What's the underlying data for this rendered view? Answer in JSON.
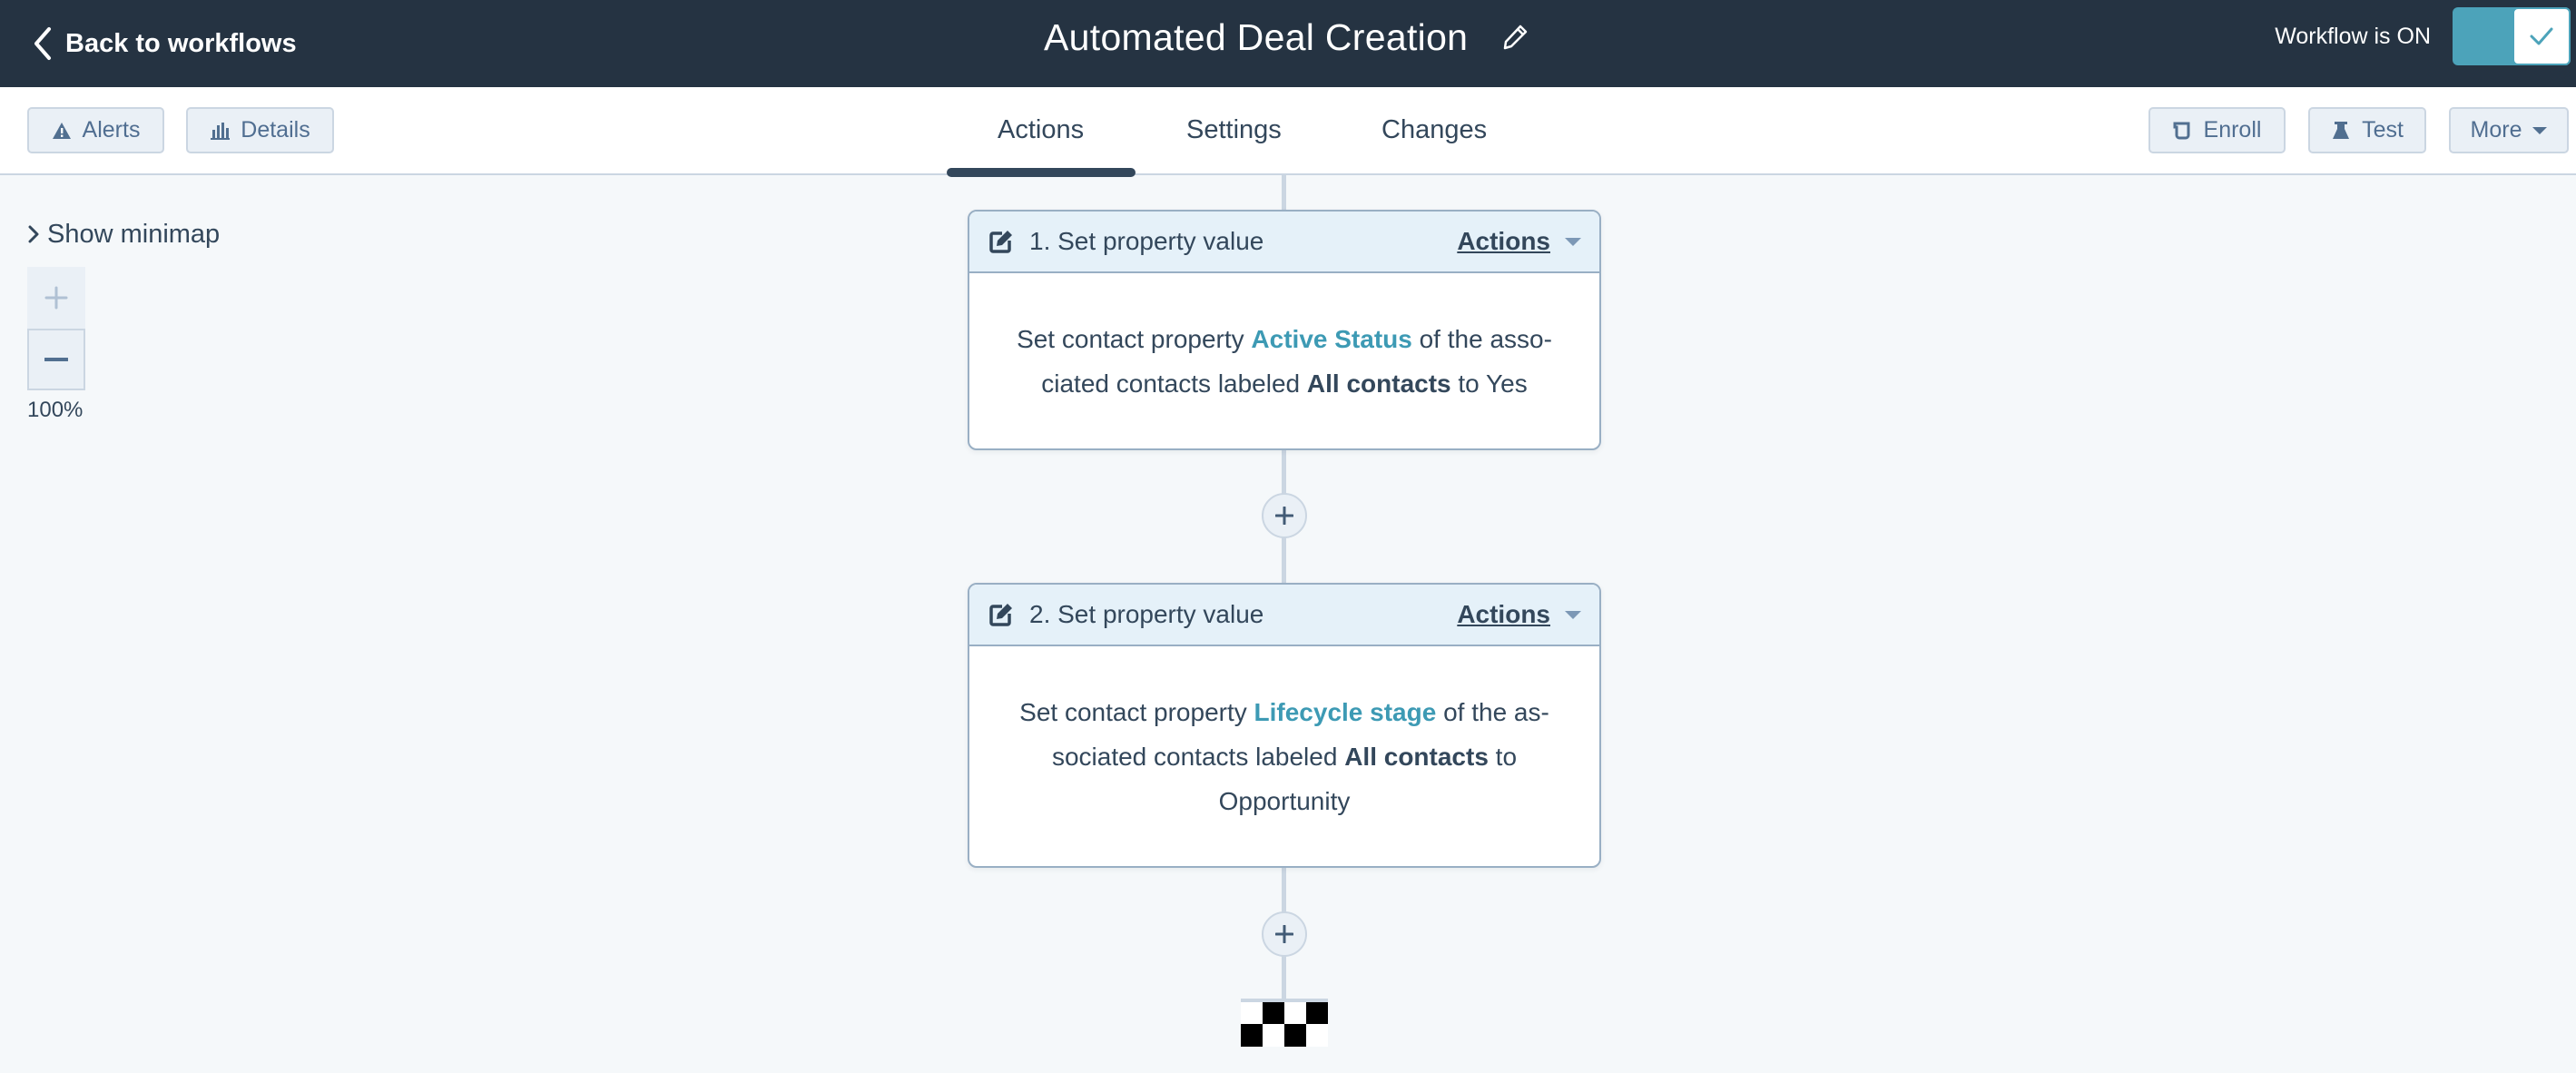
{
  "topbar": {
    "back_label": "Back to workflows",
    "title": "Automated Deal Creation",
    "status_text": "Workflow is ON",
    "toggle_on": true,
    "accent_color": "#4ca3ba",
    "background_color": "#253342"
  },
  "toolbar": {
    "left_buttons": [
      {
        "label": "Alerts",
        "icon": "warning-icon"
      },
      {
        "label": "Details",
        "icon": "bar-chart-icon"
      }
    ],
    "tabs": [
      {
        "label": "Actions",
        "active": true
      },
      {
        "label": "Settings",
        "active": false
      },
      {
        "label": "Changes",
        "active": false
      }
    ],
    "right_buttons": [
      {
        "label": "Enroll",
        "icon": "enroll-icon"
      },
      {
        "label": "Test",
        "icon": "flask-icon"
      },
      {
        "label": "More",
        "icon": "caret-down-icon"
      }
    ]
  },
  "canvas": {
    "minimap_label": "Show minimap",
    "zoom_level": "100%",
    "actions": [
      {
        "title": "1. Set property value",
        "menu_label": "Actions",
        "body": {
          "prefix": "Set contact property",
          "property": "Active Status",
          "middle": "of the asso-ciated contacts labeled",
          "label": "All contacts",
          "connector": "to",
          "value": "Yes"
        }
      },
      {
        "title": "2. Set property value",
        "menu_label": "Actions",
        "body": {
          "prefix": "Set contact property",
          "property": "Lifecycle stage",
          "middle": "of the as-sociated contacts labeled",
          "label": "All contacts",
          "connector": "to",
          "value": "Opportunity"
        }
      }
    ],
    "end_marker": "finish-flag-icon"
  }
}
